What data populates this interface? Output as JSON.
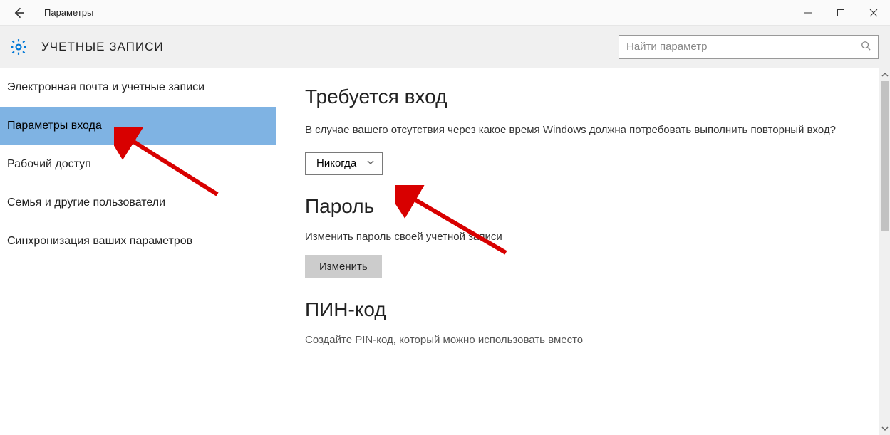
{
  "titlebar": {
    "app_title": "Параметры"
  },
  "header": {
    "section_title": "УЧЕТНЫЕ ЗАПИСИ",
    "search_placeholder": "Найти параметр"
  },
  "sidebar": {
    "items": [
      {
        "label": "Электронная почта и учетные записи",
        "selected": false
      },
      {
        "label": "Параметры входа",
        "selected": true
      },
      {
        "label": "Рабочий доступ",
        "selected": false
      },
      {
        "label": "Семья и другие пользователи",
        "selected": false
      },
      {
        "label": "Синхронизация ваших параметров",
        "selected": false
      }
    ]
  },
  "content": {
    "signin_required": {
      "heading": "Требуется вход",
      "description": "В случае вашего отсутствия через какое время Windows должна потребовать выполнить повторный вход?",
      "dropdown_value": "Никогда"
    },
    "password": {
      "heading": "Пароль",
      "description": "Изменить пароль своей учетной записи",
      "button_label": "Изменить"
    },
    "pin": {
      "heading": "ПИН-код",
      "cutoff_text": "Создайте PIN-код, который можно использовать вместо"
    }
  }
}
